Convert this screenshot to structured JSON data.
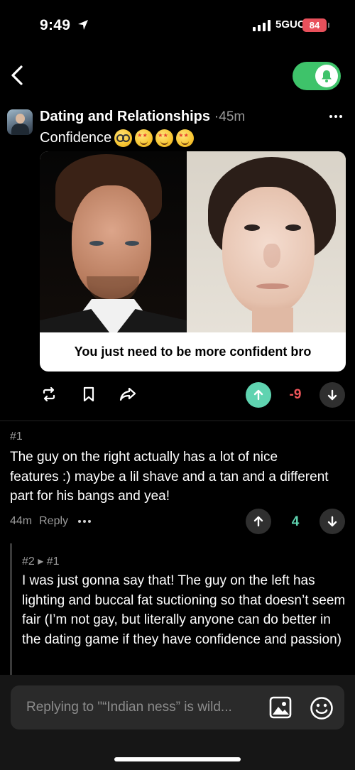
{
  "status_bar": {
    "time": "9:49",
    "network": "5GUC",
    "battery": "84"
  },
  "header": {
    "notifications_toggle": "on"
  },
  "post": {
    "community": "Dating and Relationships",
    "separator": "·",
    "age": "45m",
    "title": "Confidence",
    "title_emojis": [
      "nerd-face",
      "star-struck",
      "star-struck",
      "star-struck"
    ],
    "image_caption": "You just need to be more confident bro",
    "score": "-9",
    "upvoted": true
  },
  "comments": [
    {
      "number": "#1",
      "body": "The guy on the right actually has a lot of nice features :) maybe a lil shave and a tan and a different part for his bangs and yea!",
      "age": "44m",
      "reply_label": "Reply",
      "score": "4"
    },
    {
      "number": "#2 ▸ #1",
      "body": "I was just gonna say that! The guy on the left has lighting and buccal fat suctioning so that doesn’t seem fair (I’m not gay, but literally anyone can do better in the dating game if they have confidence and passion)"
    }
  ],
  "reply_box": {
    "placeholder": "Replying to \"“Indian ness” is wild..."
  },
  "colors": {
    "accent_green": "#3ec36a",
    "upvote_teal": "#5fd3b0",
    "negative_red": "#f0565b",
    "battery_red": "#e8505b"
  }
}
